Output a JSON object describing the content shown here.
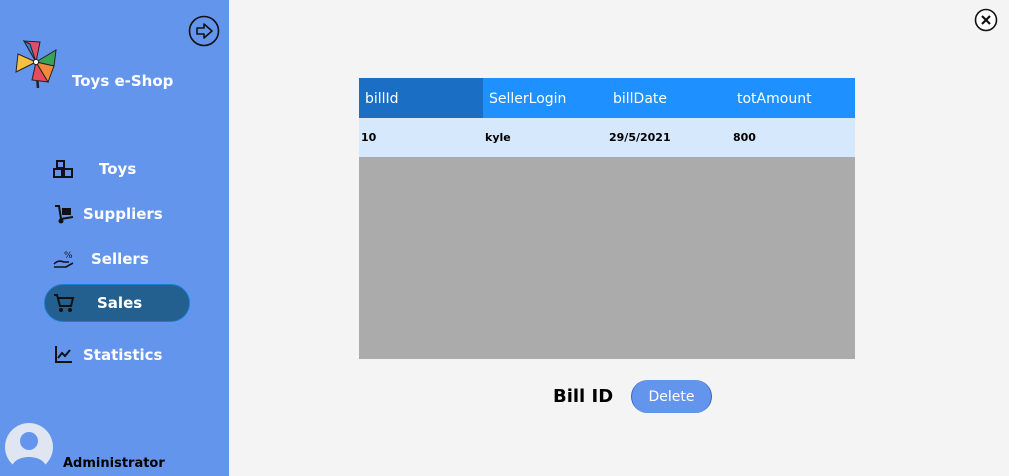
{
  "app": {
    "title": "Toys e-Shop"
  },
  "sidebar": {
    "items": [
      {
        "label": "Toys",
        "icon": "blocks-icon"
      },
      {
        "label": "Suppliers",
        "icon": "hand-truck-icon"
      },
      {
        "label": "Sellers",
        "icon": "hand-money-icon"
      },
      {
        "label": "Sales",
        "icon": "cart-icon",
        "active": true
      },
      {
        "label": "Statistics",
        "icon": "chart-icon"
      }
    ],
    "user": "Administrator"
  },
  "table": {
    "columns": [
      "billId",
      "SellerLogin",
      "billDate",
      "totAmount"
    ],
    "rows": [
      [
        "10",
        "kyle",
        "29/5/2021",
        "800"
      ]
    ]
  },
  "form": {
    "bill_label": "Bill ID",
    "delete_label": "Delete"
  },
  "colors": {
    "sidebar": "#6495ed",
    "active_item": "#235f8f",
    "header": "#1e90ff",
    "row": "#d6e8fb",
    "grid_empty": "#ababab"
  }
}
